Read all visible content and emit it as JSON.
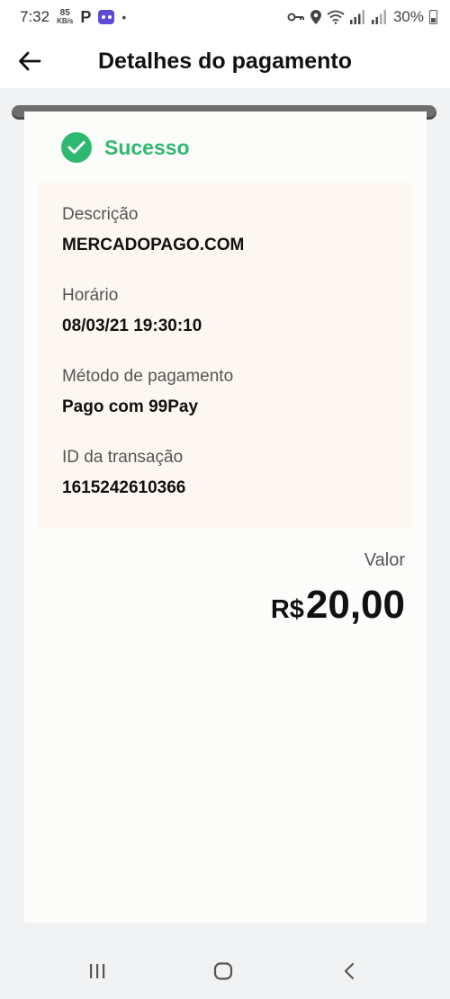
{
  "status_bar": {
    "time": "7:32",
    "net_speed_value": "85",
    "net_speed_unit": "KB/s",
    "p_icon_label": "P",
    "battery": "30%"
  },
  "header": {
    "title": "Detalhes do pagamento"
  },
  "receipt": {
    "status": "Sucesso",
    "fields": [
      {
        "label": "Descrição",
        "value": "MERCADOPAGO.COM"
      },
      {
        "label": "Horário",
        "value": "08/03/21 19:30:10"
      },
      {
        "label": "Método de pagamento",
        "value": "Pago com 99Pay"
      },
      {
        "label": "ID da transação",
        "value": "1615242610366"
      }
    ],
    "amount_label": "Valor",
    "currency": "R$",
    "amount": "20,00"
  },
  "colors": {
    "success": "#2fb86f",
    "details_background": "#fcf8f1"
  },
  "icons": {
    "back": "arrow-left-icon",
    "status": "check-circle-icon",
    "nav_recent": "recent-apps-icon",
    "nav_home": "home-icon",
    "nav_back": "chevron-left-icon"
  }
}
